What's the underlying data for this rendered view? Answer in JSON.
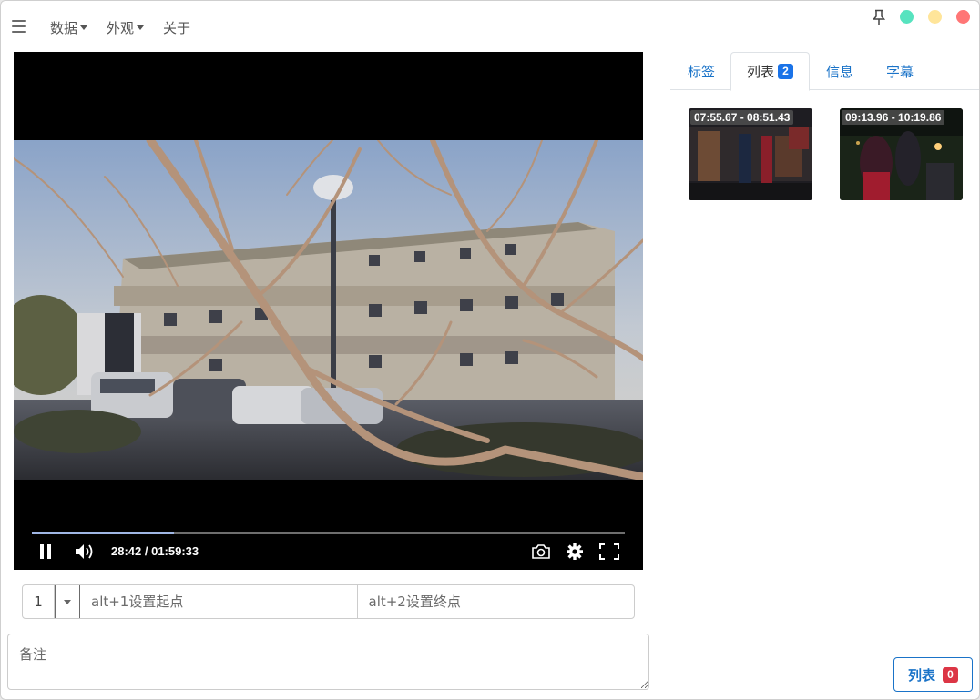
{
  "menubar": {
    "items": [
      {
        "label": "数据",
        "has_caret": true
      },
      {
        "label": "外观",
        "has_caret": true
      },
      {
        "label": "关于",
        "has_caret": false
      }
    ],
    "window_dots": {
      "green": "#57e3bf",
      "yellow": "#ffe59a",
      "red": "#ff7676"
    }
  },
  "player": {
    "progress_fraction": 0.24,
    "progress_color": "#9fb6e4",
    "time": "28:42 / 01:59:33",
    "icons": [
      "pause-icon",
      "volume-icon",
      "screenshot-icon",
      "settings-icon",
      "fullscreen-icon"
    ]
  },
  "inputs": {
    "index_value": "1",
    "start_placeholder": "alt+1设置起点",
    "end_placeholder": "alt+2设置终点",
    "notes_placeholder": "备注"
  },
  "tabs": [
    {
      "label": "标签",
      "active": false
    },
    {
      "label": "列表",
      "active": true,
      "badge": "2"
    },
    {
      "label": "信息",
      "active": false
    },
    {
      "label": "字幕",
      "active": false
    }
  ],
  "clips": [
    {
      "range": "07:55.67 - 08:51.43"
    },
    {
      "range": "09:13.96 - 10:19.86"
    }
  ],
  "list_button": {
    "label": "列表",
    "badge": "0"
  },
  "colors": {
    "accent": "#1a73c8",
    "badge_blue": "#1a73e8",
    "badge_red": "#dc3545"
  }
}
